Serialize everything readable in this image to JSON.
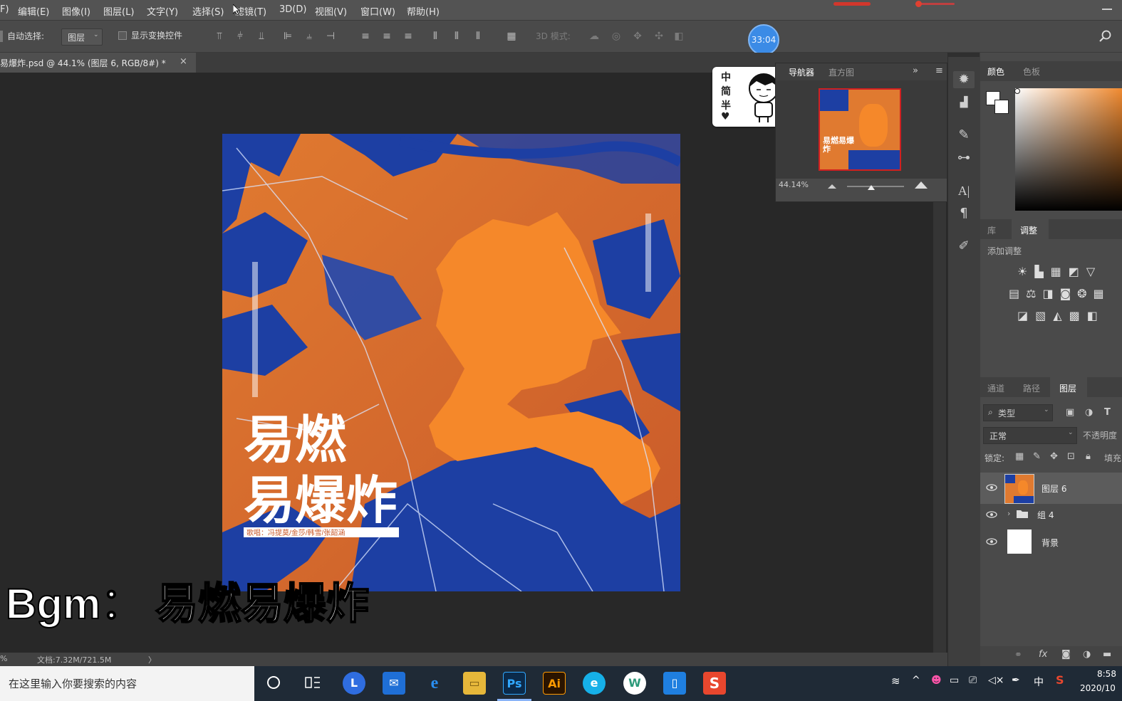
{
  "menu": {
    "items": [
      "F)",
      "编辑(E)",
      "图像(I)",
      "图层(L)",
      "文字(Y)",
      "选择(S)",
      "滤镜(T)",
      "3D(D)",
      "视图(V)",
      "窗口(W)",
      "帮助(H)"
    ]
  },
  "options": {
    "auto_select_label": "自动选择:",
    "auto_select_value": "图层",
    "show_transform_label": "显示变换控件",
    "mode_3d_label": "3D 模式:",
    "timer": "33:04"
  },
  "document": {
    "tab_title": "易爆炸.psd @ 44.1% (图层 6, RGB/8#) *",
    "close": "×",
    "status": "文档:7.32M/721.5M",
    "status_prefix": "%",
    "status_arrow": "〉"
  },
  "poster": {
    "title_line1": "易燃",
    "title_line2": "易爆炸",
    "subtitle": "歌唱：冯提莫/金莎/韩雪/张韶涵",
    "colors": {
      "orange": "#f5882a",
      "blue": "#1d3fa3",
      "deep_orange": "#d9622b"
    }
  },
  "subtitle_caption": "Bgm： 易燃易爆炸",
  "ime_badge": {
    "chars": [
      "中",
      "简",
      "半"
    ],
    "heart": "♥"
  },
  "navigator": {
    "tab_nav": "导航器",
    "tab_histogram": "直方图",
    "zoom": "44.14%",
    "thumb_text": "易燃易爆炸",
    "expand": "»",
    "menu": "≡"
  },
  "color_panel": {
    "tab_color": "颜色",
    "tab_swatches": "色板"
  },
  "adjust_panel": {
    "tab_library": "库",
    "tab_adjust": "调整",
    "add_label": "添加调整"
  },
  "layers_panel": {
    "tab_channels": "通道",
    "tab_paths": "路径",
    "tab_layers": "图层",
    "filter_label": "类型",
    "blend_mode": "正常",
    "opacity_label": "不透明度",
    "lock_label": "锁定:",
    "fill_label": "填充",
    "layers": [
      {
        "name": "图层 6"
      },
      {
        "name": "组 4"
      },
      {
        "name": "背景"
      }
    ]
  },
  "taskbar": {
    "search_placeholder": "在这里输入你要搜索的内容",
    "time": "8:58",
    "date": "2020/10",
    "ime": "中",
    "apps": [
      "Ps",
      "Ai",
      "W",
      "S"
    ]
  }
}
